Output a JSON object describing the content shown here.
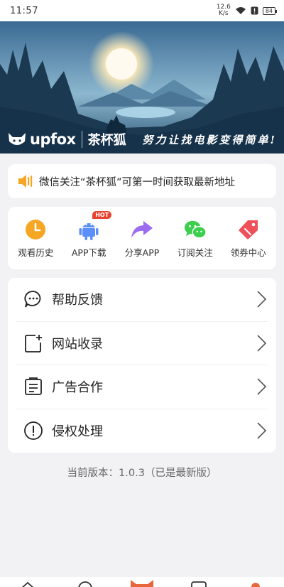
{
  "status_bar": {
    "time": "11:57",
    "speed_value": "12.6",
    "speed_unit": "K/s",
    "battery": "84"
  },
  "banner": {
    "brand_name": "upfox",
    "brand_cn": "茶杯狐",
    "slogan": "努力让找电影变得简单!"
  },
  "notice": {
    "icon": "speaker-icon",
    "text": "微信关注“茶杯狐”可第一时间获取最新地址"
  },
  "quick_actions": [
    {
      "label": "观看历史",
      "icon": "clock-icon",
      "color": "#f5a623"
    },
    {
      "label": "APP下载",
      "icon": "android-icon",
      "color": "#5b8ff9",
      "badge": "HOT"
    },
    {
      "label": "分享APP",
      "icon": "share-arrow-icon",
      "color": "#9b6cf0"
    },
    {
      "label": "订阅关注",
      "icon": "wechat-icon",
      "color": "#3ccf4e"
    },
    {
      "label": "领券中心",
      "icon": "coupon-icon",
      "color": "#f0505a"
    }
  ],
  "menu": [
    {
      "label": "帮助反馈",
      "icon": "chat-bubble-icon"
    },
    {
      "label": "网站收录",
      "icon": "add-page-icon"
    },
    {
      "label": "广告合作",
      "icon": "document-icon"
    },
    {
      "label": "侵权处理",
      "icon": "exclamation-circle-icon"
    }
  ],
  "version": "当前版本：1.0.3（已是最新版）",
  "colors": {
    "accent": "#f5a623",
    "background": "#f2f2f4",
    "banner_sky": "#3f6f95"
  }
}
